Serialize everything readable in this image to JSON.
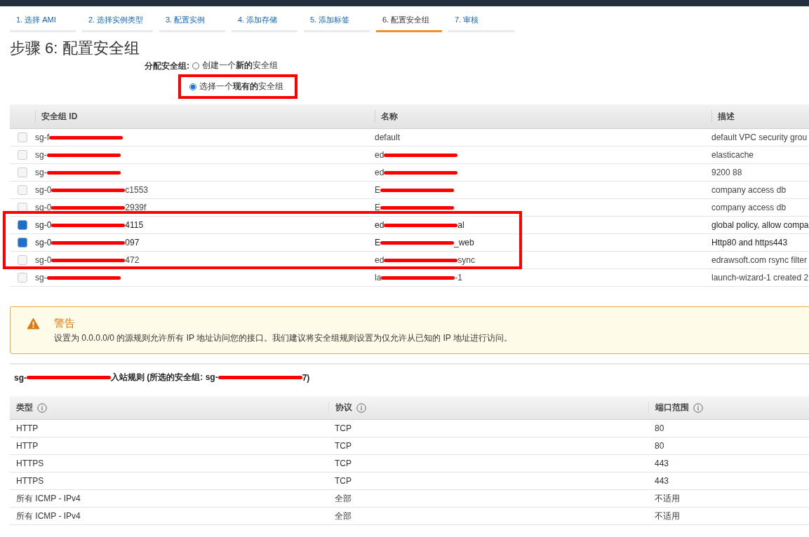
{
  "steps": [
    {
      "label": "1. 选择 AMI",
      "selected": false
    },
    {
      "label": "2. 选择实例类型",
      "selected": false
    },
    {
      "label": "3. 配置实例",
      "selected": false
    },
    {
      "label": "4. 添加存储",
      "selected": false
    },
    {
      "label": "5. 添加标签",
      "selected": false
    },
    {
      "label": "6. 配置安全组",
      "selected": true
    },
    {
      "label": "7. 审核",
      "selected": false
    }
  ],
  "heading": "步骤 6: 配置安全组",
  "assign": {
    "label": "分配安全组:",
    "options": [
      {
        "text": "创建一个**新的**安全组",
        "selected": false,
        "annotated": false
      },
      {
        "text": "选择一个**现有的**安全组",
        "selected": true,
        "annotated": true
      }
    ]
  },
  "groups_table": {
    "columns": [
      "安全组 ID",
      "名称",
      "描述"
    ],
    "rows": [
      {
        "checked": false,
        "annotated": false,
        "id": [
          {
            "kind": "text",
            "text": "sg-f"
          },
          {
            "kind": "redaction"
          }
        ],
        "name": [
          {
            "kind": "text",
            "text": "default"
          }
        ],
        "description": "default VPC security grou"
      },
      {
        "checked": false,
        "annotated": false,
        "id": [
          {
            "kind": "text",
            "text": "sg-"
          },
          {
            "kind": "redaction"
          }
        ],
        "name": [
          {
            "kind": "text",
            "text": "ed"
          },
          {
            "kind": "redaction"
          }
        ],
        "description": "elasticache"
      },
      {
        "checked": false,
        "annotated": false,
        "id": [
          {
            "kind": "text",
            "text": "sg-"
          },
          {
            "kind": "redaction"
          }
        ],
        "name": [
          {
            "kind": "text",
            "text": "ed"
          },
          {
            "kind": "redaction"
          }
        ],
        "description": "9200 88"
      },
      {
        "checked": false,
        "annotated": false,
        "id": [
          {
            "kind": "text",
            "text": "sg-0"
          },
          {
            "kind": "redaction"
          },
          {
            "kind": "text",
            "text": "c1553"
          }
        ],
        "name": [
          {
            "kind": "text",
            "text": "E"
          },
          {
            "kind": "redaction"
          }
        ],
        "description": "company access db"
      },
      {
        "checked": false,
        "annotated": false,
        "id": [
          {
            "kind": "text",
            "text": "sg-0"
          },
          {
            "kind": "redaction"
          },
          {
            "kind": "text",
            "text": "2939f"
          }
        ],
        "name": [
          {
            "kind": "text",
            "text": "E"
          },
          {
            "kind": "redaction"
          }
        ],
        "description": "company access db"
      },
      {
        "checked": true,
        "annotated": true,
        "id": [
          {
            "kind": "text",
            "text": "sg-0"
          },
          {
            "kind": "redaction"
          },
          {
            "kind": "text",
            "text": "4115"
          }
        ],
        "name": [
          {
            "kind": "text",
            "text": "ed"
          },
          {
            "kind": "redaction"
          },
          {
            "kind": "text",
            "text": "al"
          }
        ],
        "description": "global policy, allow compa"
      },
      {
        "checked": true,
        "annotated": true,
        "id": [
          {
            "kind": "text",
            "text": "sg-0"
          },
          {
            "kind": "redaction"
          },
          {
            "kind": "text",
            "text": "097"
          }
        ],
        "name": [
          {
            "kind": "text",
            "text": "E"
          },
          {
            "kind": "redaction"
          },
          {
            "kind": "text",
            "text": "_web"
          }
        ],
        "description": "Http80 and https443"
      },
      {
        "checked": false,
        "annotated": true,
        "id": [
          {
            "kind": "text",
            "text": "sg-0"
          },
          {
            "kind": "redaction"
          },
          {
            "kind": "text",
            "text": "472"
          }
        ],
        "name": [
          {
            "kind": "text",
            "text": "ed"
          },
          {
            "kind": "redaction"
          },
          {
            "kind": "text",
            "text": "sync"
          }
        ],
        "description": "edrawsoft.com rsync filter"
      },
      {
        "checked": false,
        "annotated": false,
        "id": [
          {
            "kind": "text",
            "text": "sg-"
          },
          {
            "kind": "redaction"
          }
        ],
        "name": [
          {
            "kind": "text",
            "text": "la"
          },
          {
            "kind": "redaction"
          },
          {
            "kind": "text",
            "text": "-1"
          }
        ],
        "description": "launch-wizard-1 created 2"
      }
    ]
  },
  "warning": {
    "title": "警告",
    "message": "设置为 0.0.0.0/0 的源规则允许所有 IP 地址访问您的接口。我们建议将安全组规则设置为仅允许从已知的 IP 地址进行访问。"
  },
  "rules_heading": [
    {
      "kind": "text",
      "text": "sg-"
    },
    {
      "kind": "redaction"
    },
    {
      "kind": "text",
      "text": " 入站规则 (所选的安全组: sg-"
    },
    {
      "kind": "redaction"
    },
    {
      "kind": "text",
      "text": "7)"
    }
  ],
  "rules_table": {
    "columns": [
      "类型",
      "协议",
      "端口范围"
    ],
    "rows": [
      [
        "HTTP",
        "TCP",
        "80"
      ],
      [
        "HTTP",
        "TCP",
        "80"
      ],
      [
        "HTTPS",
        "TCP",
        "443"
      ],
      [
        "HTTPS",
        "TCP",
        "443"
      ],
      [
        "所有 ICMP - IPv4",
        "全部",
        "不适用"
      ],
      [
        "所有 ICMP - IPv4",
        "全部",
        "不适用"
      ]
    ]
  }
}
